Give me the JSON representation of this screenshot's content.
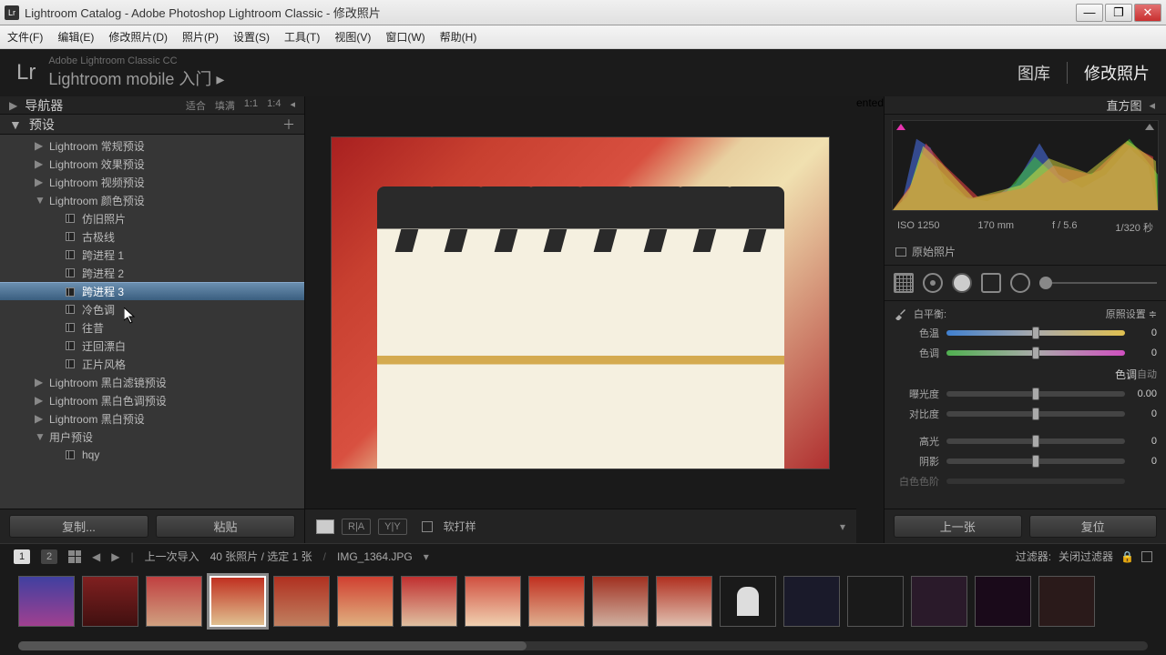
{
  "window": {
    "title": "Lightroom Catalog - Adobe Photoshop Lightroom Classic - 修改照片"
  },
  "menu": {
    "file": "文件(F)",
    "edit": "编辑(E)",
    "develop": "修改照片(D)",
    "photo": "照片(P)",
    "settings": "设置(S)",
    "tools": "工具(T)",
    "view": "视图(V)",
    "window": "窗口(W)",
    "help": "帮助(H)"
  },
  "header": {
    "brand_small": "Adobe Lightroom Classic CC",
    "brand_mobile": "Lightroom mobile 入门",
    "tab_library": "图库",
    "tab_develop": "修改照片"
  },
  "left": {
    "navigator": "导航器",
    "fit": "适合",
    "fill": "填满",
    "ratio_1_1": "1:1",
    "ratio_1_4": "1:4",
    "presets_title": "预设",
    "groups": {
      "general": "Lightroom 常规预设",
      "effect": "Lightroom 效果预设",
      "video": "Lightroom 视频预设",
      "color": "Lightroom 颜色预设",
      "bw_filter": "Lightroom 黑白滤镜预设",
      "bw_tone": "Lightroom 黑白色调预设",
      "bw": "Lightroom 黑白预设",
      "user": "用户预设"
    },
    "color_items": {
      "aged": "仿旧照片",
      "polar": "古极线",
      "cross1": "跨进程 1",
      "cross2": "跨进程 2",
      "cross3": "跨进程 3",
      "cold": "冷色调",
      "yester": "往昔",
      "bleach": "迂回漂白",
      "positive": "正片风格"
    },
    "user_items": {
      "hqy": "hqy"
    },
    "copy_btn": "复制...",
    "paste_btn": "粘贴"
  },
  "center": {
    "soft_proof": "软打样"
  },
  "right": {
    "histogram_title": "直方图",
    "exif": {
      "iso": "ISO 1250",
      "focal": "170 mm",
      "aperture": "f / 5.6",
      "shutter": "1/320 秒"
    },
    "original": "原始照片",
    "wb_label": "白平衡:",
    "wb_value": "原照设置",
    "temp_label": "色温",
    "temp_value": "0",
    "tint_label": "色调",
    "tint_value": "0",
    "tone_title": "色调",
    "auto": "自动",
    "exposure_label": "曝光度",
    "exposure_value": "0.00",
    "contrast_label": "对比度",
    "contrast_value": "0",
    "highlights_label": "高光",
    "highlights_value": "0",
    "shadows_label": "阴影",
    "shadows_value": "0",
    "whites_label": "白色色阶",
    "prev_btn": "上一张",
    "reset_btn": "复位"
  },
  "infobar": {
    "page1": "1",
    "page2": "2",
    "last_import": "上一次导入",
    "count": "40 张照片 / 选定 1 张",
    "filename": "IMG_1364.JPG",
    "filter_label": "过滤器:",
    "filter_value": "关闭过滤器"
  }
}
